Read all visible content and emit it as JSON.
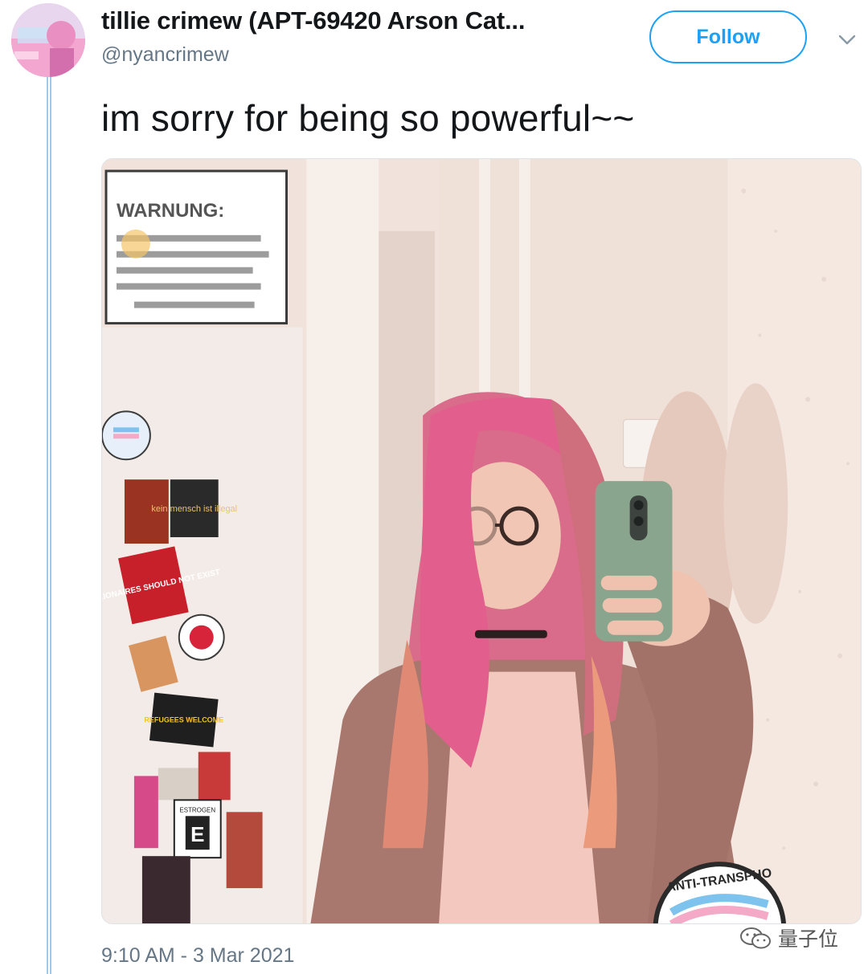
{
  "tweet": {
    "display_name": "tillie crimew (APT-69420 Arson Cat...",
    "handle": "@nyancrimew",
    "text": "im sorry for being so powerful~~",
    "timestamp": "9:10 AM - 3 Mar 2021"
  },
  "header": {
    "follow_label": "Follow",
    "menu_icon": "chevron-down-icon"
  },
  "media": {
    "sign_heading": "WARNUNG:",
    "sticker_text": [
      "BILLIONAIRES SHOULD NOT EXIST",
      "REFUGEES WELCOME",
      "kein mensch ist illegal",
      "ESTROGEN",
      "E"
    ],
    "bottom_sticker": "ANTI-TRANSPHO"
  },
  "watermark": {
    "text": "量子位"
  },
  "colors": {
    "accent": "#1da1f2",
    "secondary_text": "#657786",
    "thread_line": "#9fc8ea"
  }
}
